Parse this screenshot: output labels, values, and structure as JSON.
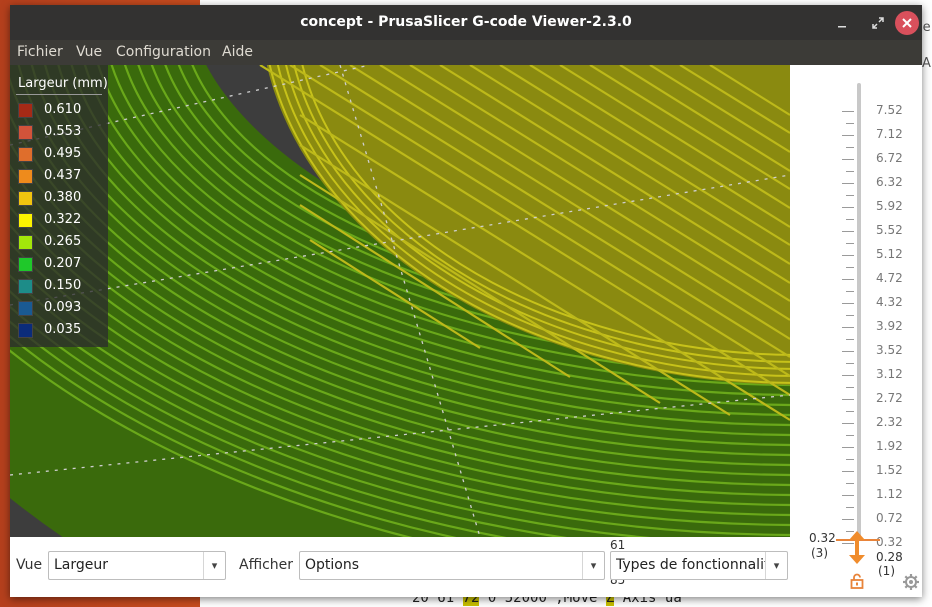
{
  "window": {
    "title": "concept - PrusaSlicer G-code Viewer-2.3.0"
  },
  "menubar": {
    "items": [
      "Fichier",
      "Vue",
      "Configuration",
      "Aide"
    ]
  },
  "legend": {
    "title": "Largeur (mm)",
    "items": [
      {
        "label": "0.610",
        "color": "#a52a16"
      },
      {
        "label": "0.553",
        "color": "#d2533a"
      },
      {
        "label": "0.495",
        "color": "#df6e2c"
      },
      {
        "label": "0.437",
        "color": "#ee8b1c"
      },
      {
        "label": "0.380",
        "color": "#f1c40f"
      },
      {
        "label": "0.322",
        "color": "#fcf300"
      },
      {
        "label": "0.265",
        "color": "#a3e60a"
      },
      {
        "label": "0.207",
        "color": "#1fc82a"
      },
      {
        "label": "0.150",
        "color": "#1d8c88"
      },
      {
        "label": "0.093",
        "color": "#1a5a92"
      },
      {
        "label": "0.035",
        "color": "#0b2c7a"
      }
    ]
  },
  "layer_slider": {
    "ticks": [
      "7.52",
      "7.12",
      "6.72",
      "6.32",
      "5.92",
      "5.52",
      "5.12",
      "4.72",
      "4.32",
      "3.92",
      "3.52",
      "3.12",
      "2.72",
      "2.32",
      "1.92",
      "1.52",
      "1.12",
      "0.72",
      "0.32",
      "0.28"
    ],
    "upper_value": "0.32",
    "upper_layer": "(3)",
    "lower_value": "0.28",
    "lower_layer": "(1)"
  },
  "bottom_bar": {
    "view_label": "Vue",
    "view_value": "Largeur",
    "show_label": "Afficher",
    "show_value": "Options",
    "features_value": "Types de fonctionnalit",
    "side_numbers": [
      "61",
      "85"
    ]
  },
  "background_window": {
    "code_parts": [
      "20 61 ",
      "72",
      " 0 52000 ;Move ",
      "Z",
      " Axis ua"
    ],
    "tab_fragment": "le",
    "tab_fragment2": "Ar"
  }
}
